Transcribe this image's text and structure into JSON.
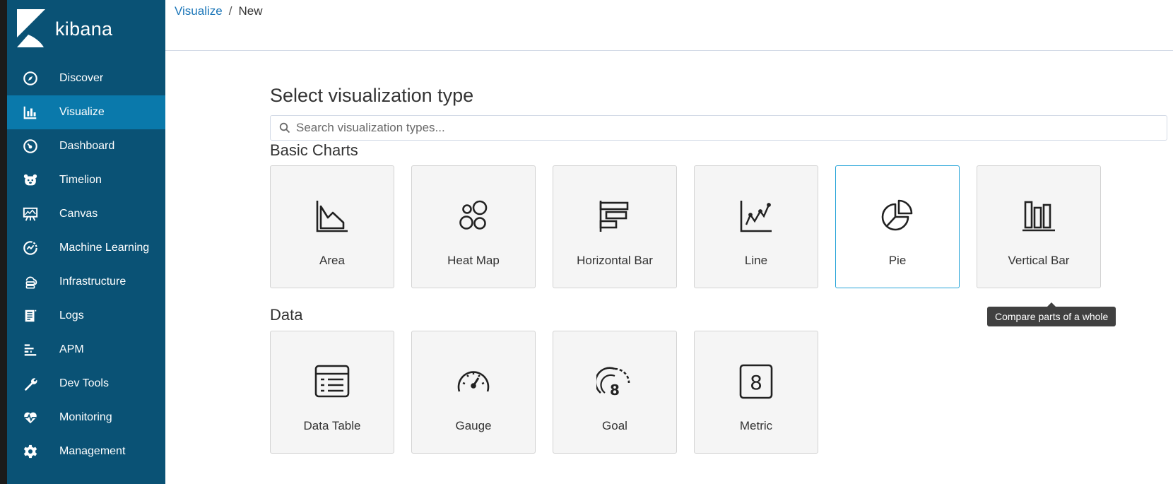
{
  "brand": {
    "name": "kibana"
  },
  "sidebar": {
    "items": [
      {
        "label": "Discover",
        "icon": "compass-icon",
        "active": false
      },
      {
        "label": "Visualize",
        "icon": "bar-chart-icon",
        "active": true
      },
      {
        "label": "Dashboard",
        "icon": "dashboard-icon",
        "active": false
      },
      {
        "label": "Timelion",
        "icon": "timelion-bear-icon",
        "active": false
      },
      {
        "label": "Canvas",
        "icon": "canvas-easel-icon",
        "active": false
      },
      {
        "label": "Machine Learning",
        "icon": "machine-learning-icon",
        "active": false
      },
      {
        "label": "Infrastructure",
        "icon": "infrastructure-icon",
        "active": false
      },
      {
        "label": "Logs",
        "icon": "logs-icon",
        "active": false
      },
      {
        "label": "APM",
        "icon": "apm-icon",
        "active": false
      },
      {
        "label": "Dev Tools",
        "icon": "wrench-icon",
        "active": false
      },
      {
        "label": "Monitoring",
        "icon": "heartbeat-icon",
        "active": false
      },
      {
        "label": "Management",
        "icon": "gear-icon",
        "active": false
      }
    ]
  },
  "breadcrumb": {
    "link": "Visualize",
    "separator": "/",
    "current": "New"
  },
  "main": {
    "title": "Select visualization type",
    "search": {
      "placeholder": "Search visualization types...",
      "value": ""
    },
    "sections": [
      {
        "heading": "Basic Charts",
        "cards": [
          {
            "label": "Area",
            "icon": "area-chart-icon"
          },
          {
            "label": "Heat Map",
            "icon": "heat-map-icon"
          },
          {
            "label": "Horizontal Bar",
            "icon": "horizontal-bar-icon"
          },
          {
            "label": "Line",
            "icon": "line-chart-icon"
          },
          {
            "label": "Pie",
            "icon": "pie-chart-icon",
            "hovered": true
          },
          {
            "label": "Vertical Bar",
            "icon": "vertical-bar-icon"
          }
        ]
      },
      {
        "heading": "Data",
        "cards": [
          {
            "label": "Data Table",
            "icon": "data-table-icon"
          },
          {
            "label": "Gauge",
            "icon": "gauge-icon"
          },
          {
            "label": "Goal",
            "icon": "goal-icon"
          },
          {
            "label": "Metric",
            "icon": "metric-icon"
          }
        ]
      }
    ],
    "tooltip": "Compare parts of a whole"
  },
  "colors": {
    "sidebar_bg": "#0a5275",
    "sidebar_active": "#0a79ab",
    "link": "#1a75b8",
    "hover_border": "#27a4d8",
    "tooltip_bg": "#404040"
  }
}
